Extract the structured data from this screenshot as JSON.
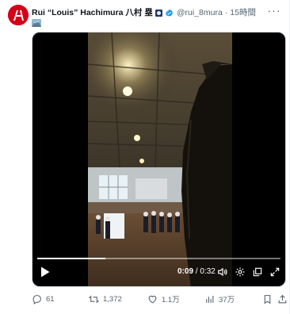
{
  "post": {
    "author_name": "Rui “Louis” Hachimura 八村 塁",
    "handle": "@rui_8mura",
    "separator": "·",
    "time": "15時間",
    "more_label": "···"
  },
  "video": {
    "current_time": "0:09",
    "divider": " / ",
    "duration": "0:32",
    "progress_fraction": 0.28
  },
  "actions": {
    "replies": "61",
    "reposts": "1,372",
    "likes": "1.1万",
    "views": "37万"
  },
  "colors": {
    "avatar_red": "#d60019",
    "verified_blue": "#1d9bf0",
    "secondary_text": "#536471"
  },
  "icons": [
    "more-icon",
    "verified-icon",
    "flag-icon",
    "play-icon",
    "volume-icon",
    "settings-icon",
    "popout-icon",
    "fullscreen-icon",
    "reply-icon",
    "repost-icon",
    "like-icon",
    "views-icon",
    "bookmark-icon",
    "share-icon"
  ]
}
